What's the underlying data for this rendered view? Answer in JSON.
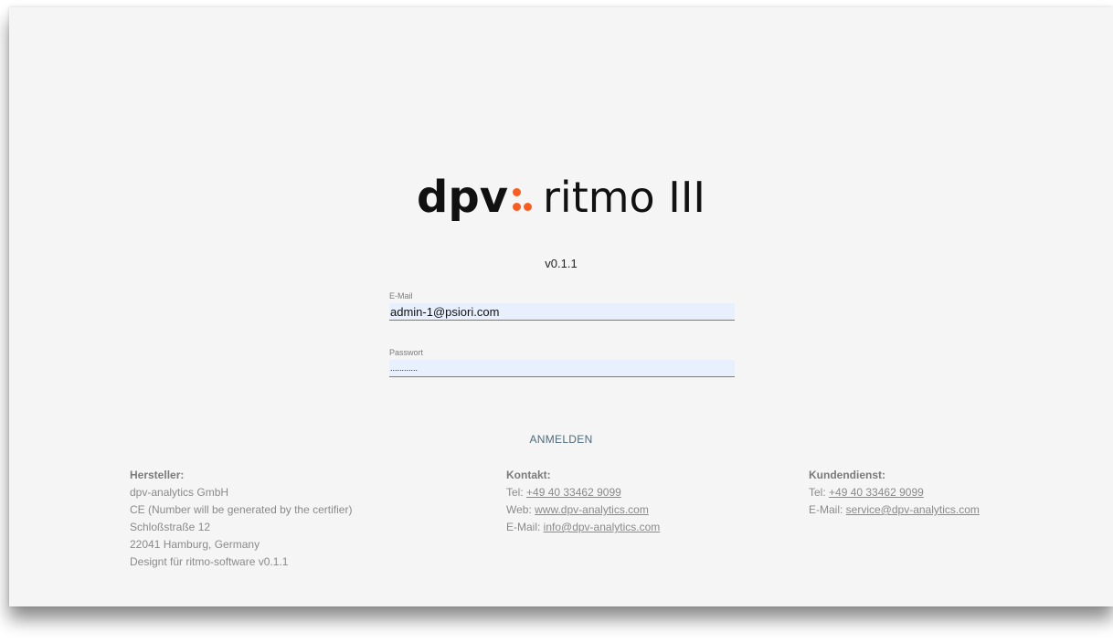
{
  "logo": {
    "brand": "dpv",
    "product": "ritmo III",
    "dot_color": "#ff5a1f"
  },
  "version": "v0.1.1",
  "form": {
    "email": {
      "label": "E-Mail",
      "value": "admin-1@psiori.com"
    },
    "password": {
      "label": "Passwort",
      "value": "............"
    },
    "submit_label": "ANMELDEN"
  },
  "footer": {
    "manufacturer": {
      "heading": "Hersteller:",
      "lines": [
        "dpv-analytics GmbH",
        "CE (Number will be generated by the certifier)",
        "Schloßstraße 12",
        "22041 Hamburg, Germany",
        "Designt für ritmo-software v0.1.1"
      ]
    },
    "contact": {
      "heading": "Kontakt:",
      "tel_prefix": "Tel: ",
      "tel": "+49 40 33462 9099",
      "web_prefix": "Web: ",
      "web": "www.dpv-analytics.com",
      "email_prefix": "E-Mail: ",
      "email": "info@dpv-analytics.com"
    },
    "support": {
      "heading": "Kundendienst:",
      "tel_prefix": "Tel: ",
      "tel": "+49 40 33462 9099",
      "email_prefix": "E-Mail: ",
      "email": "service@dpv-analytics.com"
    }
  },
  "colors": {
    "background": "#f5f5f5",
    "input_fill": "#e8f0fe",
    "button_text": "#4f6b7c",
    "footer_text": "#8a8a8a"
  }
}
